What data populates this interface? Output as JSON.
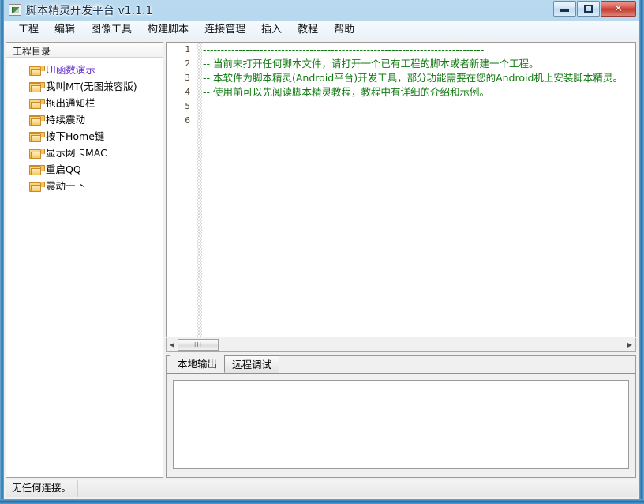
{
  "window": {
    "title": "脚本精灵开发平台 v1.1.1",
    "icon": "app-icon",
    "buttons": {
      "minimize": "minimize-icon",
      "maximize": "maximize-icon",
      "close": "✕"
    }
  },
  "menubar": {
    "items": [
      {
        "label": "工程"
      },
      {
        "label": "编辑"
      },
      {
        "label": "图像工具"
      },
      {
        "label": "构建脚本"
      },
      {
        "label": "连接管理"
      },
      {
        "label": "插入"
      },
      {
        "label": "教程"
      },
      {
        "label": "帮助"
      }
    ]
  },
  "tree": {
    "header": "工程目录",
    "items": [
      {
        "label": "UI函数演示",
        "accent": true
      },
      {
        "label": "我叫MT(无图兼容版)",
        "accent": false
      },
      {
        "label": "拖出通知栏",
        "accent": false
      },
      {
        "label": "持续震动",
        "accent": false
      },
      {
        "label": "按下Home键",
        "accent": false
      },
      {
        "label": "显示网卡MAC",
        "accent": false
      },
      {
        "label": "重启QQ",
        "accent": false
      },
      {
        "label": "震动一下",
        "accent": false
      }
    ]
  },
  "editor": {
    "line_numbers": [
      "1",
      "2",
      "3",
      "4",
      "5",
      "6"
    ],
    "lines": [
      "-------------------------------------------------------------------------------",
      "-- 当前未打开任何脚本文件，请打开一个已有工程的脚本或者新建一个工程。",
      "-- 本软件为脚本精灵(Android平台)开发工具，部分功能需要在您的Android机上安装脚本精灵。",
      "-- 使用前可以先阅读脚本精灵教程，教程中有详细的介绍和示例。",
      "-------------------------------------------------------------------------------",
      ""
    ],
    "comment_color": "#127a12",
    "scrollbar": {
      "left_arrow": "◀",
      "right_arrow": "▶",
      "thumb_grip": "III"
    }
  },
  "output": {
    "tabs": [
      {
        "label": "本地输出",
        "active": true
      },
      {
        "label": "远程调试",
        "active": false
      }
    ],
    "content": ""
  },
  "statusbar": {
    "text": "无任何连接。"
  },
  "colors": {
    "accent_link": "#6633cc",
    "comment_green": "#127a12",
    "frame_blue": "#1b6aa8",
    "close_red": "#bf3a2c"
  }
}
